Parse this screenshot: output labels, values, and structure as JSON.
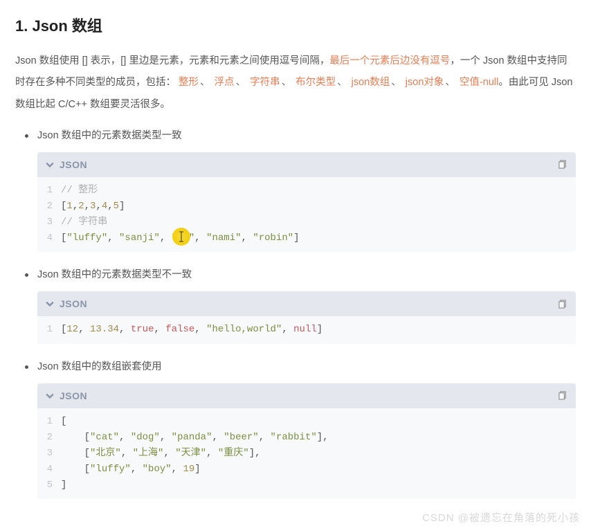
{
  "heading": "1. Json 数组",
  "para": {
    "p1": "Json 数组使用 [] 表示，[] 里边是元素，元素和元素之间使用逗号间隔，",
    "hl1": "最后一个元素后边没有逗号",
    "p2": "，一个 Json 数组中支持同时存在多种不同类型的成员，包括：",
    "t1": "整形",
    "t2": "浮点",
    "t3": "字符串",
    "t4": "布尔类型",
    "t5": "json数组",
    "t6": "json对象",
    "t7": "空值-null",
    "p3": "。由此可见 Json 数组比起 C/C++ 数组要灵活很多。"
  },
  "sep": "、",
  "bullets": {
    "b1": "Json 数组中的元素数据类型一致",
    "b2": "Json 数组中的元素数据类型不一致",
    "b3": "Json 数组中的数组嵌套使用"
  },
  "code_header": "JSON",
  "code1": {
    "l1": "// 整形",
    "l2a": "[",
    "l2b": "1",
    "l2c": ",",
    "l2d": "2",
    "l2e": ",",
    "l2f": "3",
    "l2g": ",",
    "l2h": "4",
    "l2i": ",",
    "l2j": "5",
    "l2k": "]",
    "l3": "// 字符串",
    "l4a": "[",
    "l4b": "\"luffy\"",
    "l4c": ", ",
    "l4d": "\"sanji\"",
    "l4e": ", ",
    "l4f": "\"z",
    "l4g": "o\"",
    "l4h": ", ",
    "l4i": "\"nami\"",
    "l4j": ", ",
    "l4k": "\"robin\"",
    "l4l": "]"
  },
  "code2": {
    "l1a": "[",
    "l1b": "12",
    "l1c": ", ",
    "l1d": "13.34",
    "l1e": ", ",
    "l1f": "true",
    "l1g": ", ",
    "l1h": "false",
    "l1i": ", ",
    "l1j": "\"hello,world\"",
    "l1k": ", ",
    "l1l": "null",
    "l1m": "]"
  },
  "code3": {
    "l1": "[",
    "l2a": "    [",
    "l2b": "\"cat\"",
    "l2c": ", ",
    "l2d": "\"dog\"",
    "l2e": ", ",
    "l2f": "\"panda\"",
    "l2g": ", ",
    "l2h": "\"beer\"",
    "l2i": ", ",
    "l2j": "\"rabbit\"",
    "l2k": "],",
    "l3a": "    [",
    "l3b": "\"北京\"",
    "l3c": ", ",
    "l3d": "\"上海\"",
    "l3e": ", ",
    "l3f": "\"天津\"",
    "l3g": ", ",
    "l3h": "\"重庆\"",
    "l3i": "],",
    "l4a": "    [",
    "l4b": "\"luffy\"",
    "l4c": ", ",
    "l4d": "\"boy\"",
    "l4e": ", ",
    "l4f": "19",
    "l4g": "]",
    "l5": "]"
  },
  "ln": {
    "n1": "1",
    "n2": "2",
    "n3": "3",
    "n4": "4",
    "n5": "5"
  },
  "watermark": "CSDN @被遗忘在角落的死小孩"
}
